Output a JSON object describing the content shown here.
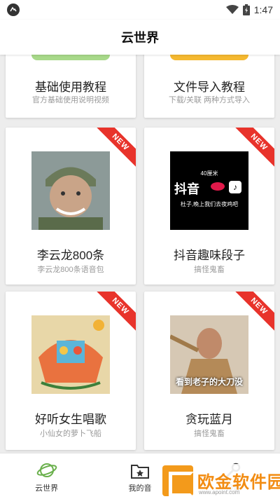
{
  "status_bar": {
    "time": "1:47",
    "icons": [
      "app-notification-icon",
      "wifi-icon",
      "battery-charging-icon"
    ]
  },
  "header": {
    "title": "云世界"
  },
  "cards": [
    {
      "title": "基础使用教程",
      "subtitle": "官方基础使用说明视频",
      "pill_color": "#a8d98a"
    },
    {
      "title": "文件导入教程",
      "subtitle": "下载/关联 两种方式导入",
      "pill_color": "#f5b930"
    },
    {
      "title": "李云龙800条",
      "subtitle": "李云龙800条语音包",
      "badge": "NEW"
    },
    {
      "title": "抖音趣味段子",
      "subtitle": "搞怪鬼畜",
      "badge": "NEW",
      "thumb_text_top": "40厘米",
      "thumb_logo": "抖音",
      "thumb_caption": "杜子,晚上我们去夜鸡吧"
    },
    {
      "title": "好听女生唱歌",
      "subtitle": "小仙女的萝卜飞船",
      "badge": "NEW"
    },
    {
      "title": "贪玩蓝月",
      "subtitle": "搞怪鬼畜",
      "badge": "NEW",
      "thumb_caption": "看到老子的大刀没"
    }
  ],
  "bottom_nav": {
    "items": [
      {
        "label": "云世界",
        "icon": "planet-icon"
      },
      {
        "label": "我的音",
        "icon": "folder-star-icon"
      },
      {
        "label": "设置",
        "icon": "wrench-icon"
      }
    ]
  },
  "watermark": {
    "text": "欧金软件园",
    "url": "www.apoint.com"
  },
  "colors": {
    "accent_green": "#6ab04c",
    "badge_red": "#e8332b",
    "watermark_orange": "#f28c12"
  }
}
